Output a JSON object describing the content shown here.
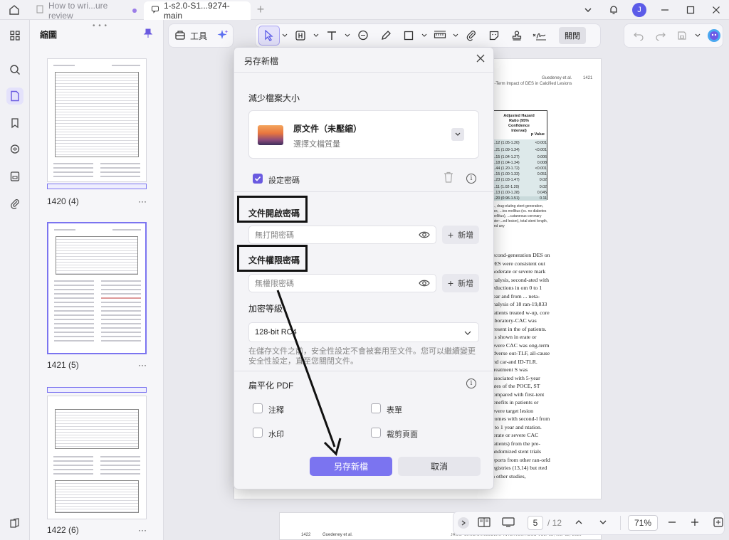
{
  "titlebar": {
    "tabs": [
      {
        "label": "How to wri...ure review"
      },
      {
        "label": "1-s2.0-S1...9274-main"
      }
    ],
    "avatar_initial": "J"
  },
  "thumbnails": {
    "header": "縮圖",
    "pages": [
      {
        "caption": "1420 (4)"
      },
      {
        "caption": "1421 (5)"
      },
      {
        "caption": "1422 (6)"
      }
    ],
    "more": "···"
  },
  "toolbar": {
    "tools_label": "工具",
    "close_label": "關閉"
  },
  "document": {
    "header_author": "Guedeney et al.",
    "header_page": "1421",
    "header_title": "Long-Term Impact of DES in Calcified Lesions",
    "table_header": "Adjusted Hazard Ratio (95% Confidence Interval)",
    "table_p_header": "p Value",
    "table_rows": [
      {
        "hr": "1.12 (1.05-1.20)",
        "p": "<0.001"
      },
      {
        "hr": "1.21 (1.09-1.34)",
        "p": "<0.001"
      },
      {
        "hr": "1.15 (1.04-1.27)",
        "p": "0.006"
      },
      {
        "hr": "1.18 (1.04-1.34)",
        "p": "0.008"
      },
      {
        "hr": "1.44 (1.20-1.72)",
        "p": "<0.001"
      },
      {
        "hr": "1.15 (1.00-1.33)",
        "p": "0.051"
      },
      {
        "hr": "1.23 (1.03-1.47)",
        "p": "0.02"
      },
      {
        "hr": "1.11 (1.02-1.20)",
        "p": "0.02"
      },
      {
        "hr": "1.13 (1.00-1.28)",
        "p": "0.045"
      },
      {
        "hr": "1.20 (0.96-1.51)",
        "p": "0.11"
      }
    ],
    "table_footnote": "..., drug-eluting stent generation, sex, ...tes mellitus (vs. no diabetes mellitus), ...cutaneous coronary inter-...ed lesion), total stent length, and any",
    "body_text": "second-generation DES on DES were consistent out moderate or severe mark analysis, second-ated with reductions in om 0 to 1 year and from ... neta-analysis of 18 ran-19,833 patients treated w-up, core laboratory-CAC was present in the of patients. As shown in erate or severe CAC was ong-term adverse out-TLF, all-cause and car-and ID-TLR. Treatment S was associated with 5-year rates of the POCE, ST compared with first-tent benefits in patients or severe target lesion tcomes with second-l from 0 to 1 year and ntation. derate or severe CAC patients) from the pre-randomized stent trials reports from other ran-orld registries (13,14) but rted in other studies,",
    "footer_page": "1422",
    "footer_author": "Guedeney et al.",
    "footer_journal": "JACC: CARDIOVASCULAR INTERVENTIONS VOL. 13, NO. 12, 2020"
  },
  "pager": {
    "current_page": "5",
    "total_pages": "/ 12",
    "zoom": "71%"
  },
  "dialog": {
    "title": "另存新檔",
    "reduce_size_label": "減少檔案大小",
    "quality_title": "原文件（未壓縮）",
    "quality_subtitle": "選擇文檔質量",
    "set_password_label": "設定密碼",
    "open_password_label": "文件開啟密碼",
    "open_password_placeholder": "無打開密碼",
    "permission_password_label": "文件權限密碼",
    "permission_password_placeholder": "無權限密碼",
    "add_label": "新增",
    "encryption_label": "加密等級",
    "encryption_value": "128-bit RC4",
    "note": "在儲存文件之前，安全性設定不會被套用至文件。您可以繼續變更安全性設定，直至您關閉文件。",
    "flatten_label": "扁平化 PDF",
    "flatten_options": [
      {
        "label": "注釋"
      },
      {
        "label": "表單"
      },
      {
        "label": "水印"
      },
      {
        "label": "裁剪頁面"
      }
    ],
    "save_as_label": "另存新檔",
    "cancel_label": "取消"
  }
}
